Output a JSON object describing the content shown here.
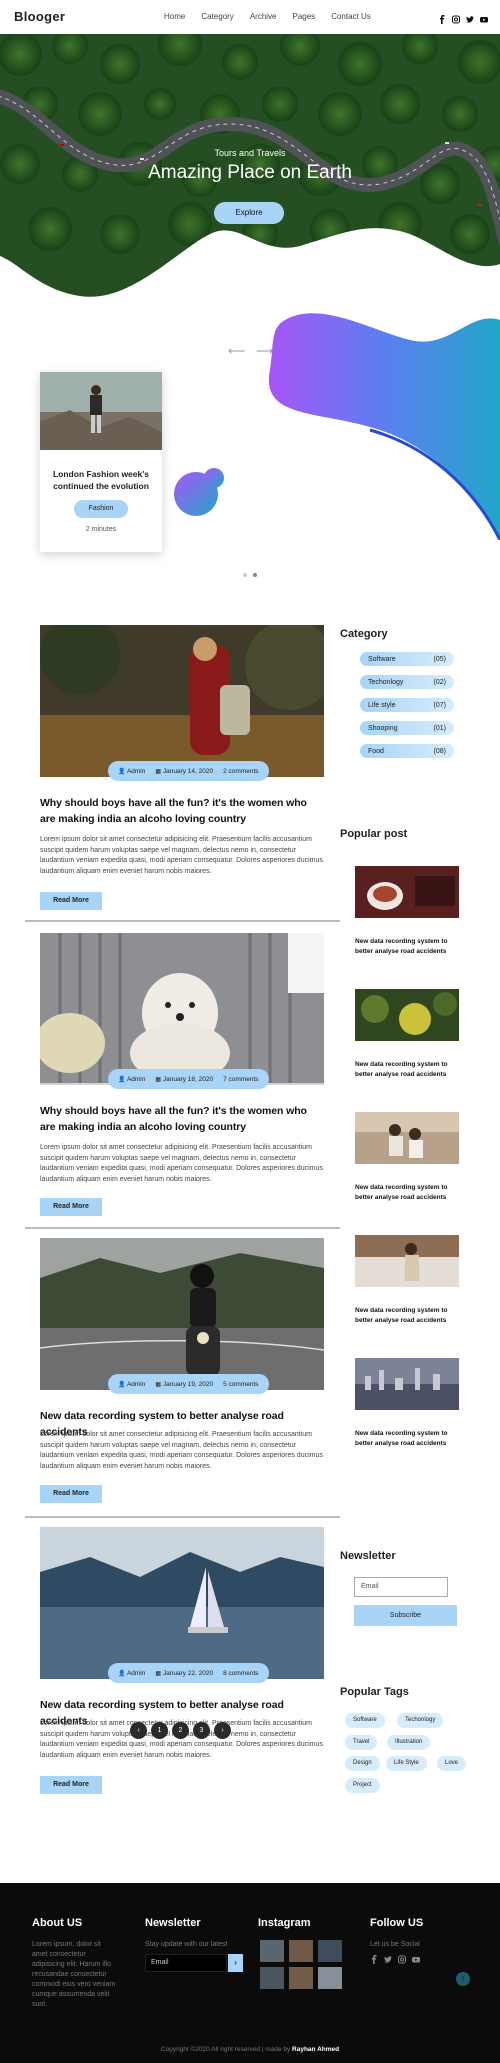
{
  "header": {
    "logo": "Blooger",
    "nav": [
      "Home",
      "Category",
      "Archive",
      "Pages",
      "Contact Us"
    ],
    "social_icons": [
      "facebook-icon",
      "instagram-icon",
      "twitter-icon",
      "youtube-icon"
    ]
  },
  "hero": {
    "subtitle": "Tours and Travels",
    "title": "Amazing Place on Earth",
    "button": "Explore"
  },
  "slider": {
    "card": {
      "title": "London Fashion week's continued the evolution",
      "tag": "Fashion",
      "time": "2 minutes"
    },
    "dots": 2,
    "active_dot": 2
  },
  "posts": [
    {
      "author": "Admin",
      "date": "January 14, 2020",
      "comments": "2 comments",
      "title": "Why should boys have all the fun? it's the women who are making india an alcoho loving country",
      "text": "Lorem ipsum dolor sit amet consectetur adipisicing elit. Praesentium facilis accusantium suscipit quidem harum voluptas saepe vel magnam, delectus nemo in, consectetur laudantium veniam expedita quasi, modi aperiam consequatur. Dolores asperiores ducimus laudantium aliquam enim eveniet harum nobis maiores.",
      "read_more": "Read More"
    },
    {
      "author": "Admin",
      "date": "January 18, 2020",
      "comments": "7 comments",
      "title": "Why should boys have all the fun? it's the women who are making india an alcoho loving country",
      "text": "Lorem ipsum dolor sit amet consectetur adipisicing elit. Praesentium facilis accusantium suscipit quidem harum voluptas saepe vel magnam, delectus nemo in, consectetur laudantium veniam expedita quasi, modi aperiam consequatur. Dolores asperiores ducimus laudantium aliquam enim eveniet harum nobis maiores.",
      "read_more": "Read More"
    },
    {
      "author": "Admin",
      "date": "January 19, 2020",
      "comments": "5 comments",
      "title": "New data recording system to better analyse road accidents",
      "text": "Lorem ipsum dolor sit amet consectetur adipisicing elit. Praesentium facilis accusantium suscipit quidem harum voluptas saepe vel magnam, delectus nemo in, consectetur laudantium veniam expedita quasi, modi aperiam consequatur. Dolores asperiores ducimus laudantium aliquam enim eveniet harum nobis maiores.",
      "read_more": "Read More"
    },
    {
      "author": "Admin",
      "date": "January 22, 2020",
      "comments": "8 comments",
      "title": "New data recording system to better analyse road accidents",
      "text": "Lorem ipsum dolor sit amet consectetur adipisicing elit. Praesentium facilis accusantium suscipit quidem harum voluptas saepe vel magnam, delectus nemo in, consectetur laudantium veniam expedita quasi, modi aperiam consequatur. Dolores asperiores ducimus laudantium aliquam enim eveniet harum nobis maiores.",
      "read_more": "Read More"
    }
  ],
  "sidebar": {
    "category_title": "Category",
    "categories": [
      {
        "name": "Software",
        "count": "(05)"
      },
      {
        "name": "Techonlogy",
        "count": "(02)"
      },
      {
        "name": "Life style",
        "count": "(07)"
      },
      {
        "name": "Shooping",
        "count": "(01)"
      },
      {
        "name": "Food",
        "count": "(08)"
      }
    ],
    "popular_title": "Popular post",
    "popular_posts": [
      "New data recording system to better analyse road accidents",
      "New data recording system to better analyse road accidents",
      "New data recording system to better analyse road accidents",
      "New data recording system to better analyse road accidents",
      "New data recording system to better analyse road accidents"
    ],
    "newsletter_title": "Newsletter",
    "email_placeholder": "Email",
    "subscribe": "Subscribe",
    "tags_title": "Popular Tags",
    "tags": [
      "Software",
      "Techonlogy",
      "Travel",
      "Illustration",
      "Design",
      "Life Style",
      "Love",
      "Project"
    ]
  },
  "pagination": {
    "prev": "‹",
    "pages": [
      "1",
      "2",
      "3"
    ],
    "next": "›"
  },
  "footer": {
    "about_title": "About US",
    "about_text": "Lorem ipsum, dolor sit amet consectetur adipisicing elit. Harum illo recusandae consectetur commodi eius vero veniam cumque assumenda velit sunt.",
    "newsletter_title": "Newsletter",
    "newsletter_text": "Stay update with our latest",
    "email_placeholder": "Email",
    "submit": "›",
    "instagram_title": "Instagram",
    "follow_title": "Follow US",
    "follow_text": "Let us be Social",
    "copyright": "Copyright ©2020 All right reserved | made by",
    "author": "Rayhan Ahmed",
    "to_top": "↑"
  },
  "colors": {
    "accent": "#a8d4f7",
    "blob_start": "#a855f7",
    "blob_end": "#22a6c8",
    "footer_bg": "#0b0b0b"
  }
}
